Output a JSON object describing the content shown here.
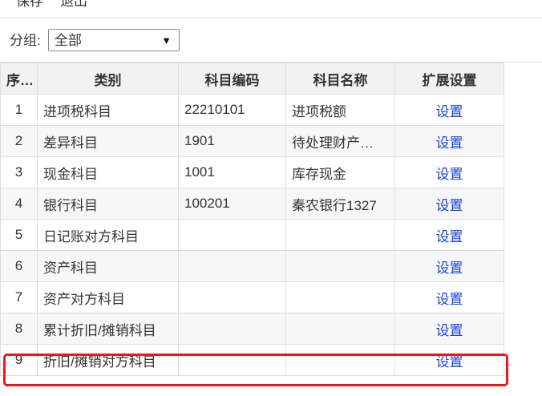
{
  "toolbar": {
    "save_label": "保存",
    "exit_label": "退出"
  },
  "filter": {
    "label": "分组:",
    "selected": "全部"
  },
  "table": {
    "headers": [
      "序号",
      "类别",
      "科目编码",
      "科目名称",
      "扩展设置"
    ],
    "rows": [
      {
        "idx": "1",
        "category": "进项税科目",
        "code": "22210101",
        "name": "进项税额",
        "action": "设置"
      },
      {
        "idx": "2",
        "category": "差异科目",
        "code": "1901",
        "name": "待处理财产…",
        "action": "设置"
      },
      {
        "idx": "3",
        "category": "现金科目",
        "code": "1001",
        "name": "库存现金",
        "action": "设置"
      },
      {
        "idx": "4",
        "category": "银行科目",
        "code": "100201",
        "name": "秦农银行1327",
        "action": "设置"
      },
      {
        "idx": "5",
        "category": "日记账对方科目",
        "code": "",
        "name": "",
        "action": "设置"
      },
      {
        "idx": "6",
        "category": "资产科目",
        "code": "",
        "name": "",
        "action": "设置"
      },
      {
        "idx": "7",
        "category": "资产对方科目",
        "code": "",
        "name": "",
        "action": "设置"
      },
      {
        "idx": "8",
        "category": "累计折旧/摊销科目",
        "code": "",
        "name": "",
        "action": "设置"
      },
      {
        "idx": "9",
        "category": "折旧/摊销对方科目",
        "code": "",
        "name": "",
        "action": "设置"
      }
    ]
  },
  "colors": {
    "link": "#1a3fd6",
    "highlight": "#e8191c",
    "header_bg": "#f2f2f2"
  },
  "icons": {
    "dropdown": "chevron-down-icon"
  }
}
